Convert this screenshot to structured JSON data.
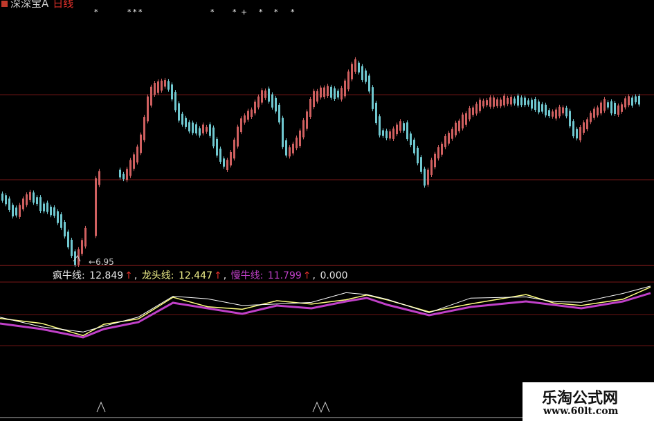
{
  "header": {
    "stock_name": "深深宝A",
    "period": "日线",
    "signal_marks": [
      "*",
      "*",
      "*",
      "*",
      "*",
      "*",
      "+",
      "*",
      "*",
      "*"
    ]
  },
  "price_panel": {
    "low_label": "6.95"
  },
  "indicator": {
    "name1": "疯牛线:",
    "value1": "12.849",
    "name2": "龙头线:",
    "value2": "12.447",
    "name3": "慢牛线:",
    "value3": "11.799",
    "arrow": "↑",
    "extra_value": "0.000",
    "colors": {
      "crazy_bull": "#ffffff",
      "dragon_head": "#ffff80",
      "slow_bull": "#c040c8"
    }
  },
  "colors": {
    "up_candle": "#d06060",
    "down_candle": "#70c8d0",
    "grid_line": "#8b1a1a",
    "background": "#000000"
  },
  "watermark": {
    "title": "乐淘公式网",
    "url": "www.60lt.com"
  }
}
